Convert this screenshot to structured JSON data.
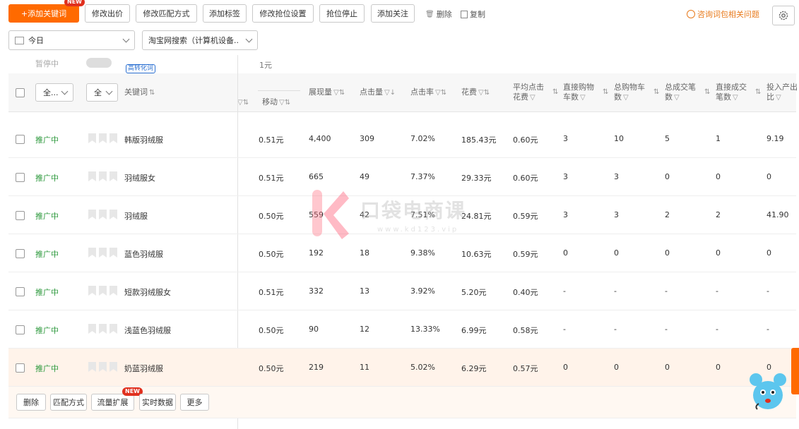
{
  "toolbar": {
    "add_keyword": "+添加关键词",
    "new_badge": "NEW",
    "modify_bid": "修改出价",
    "modify_match": "修改匹配方式",
    "add_tag": "添加标签",
    "modify_rank": "修改抢位设置",
    "stop_rank": "抢位停止",
    "add_follow": "添加关注",
    "delete": "删除",
    "copy": "复制",
    "consult": "咨询词包相关问题"
  },
  "filters": {
    "date": "今日",
    "channel": "淘宝网搜索（计算机设备..."
  },
  "partial_row": {
    "status": "暂停中",
    "badge": "高转化词",
    "value": "1元"
  },
  "header": {
    "status_select": "全...",
    "type_select": "全",
    "keyword": "关键词",
    "mobile": "移动",
    "impressions": "展现量",
    "clicks": "点击量",
    "ctr": "点击率",
    "cost": "花费",
    "avg_cpc": "平均点击花费",
    "direct_cart": "直接购物车数",
    "total_cart": "总购物车数",
    "total_orders": "总成交笔数",
    "direct_orders": "直接成交笔数",
    "roi": "投入产出比"
  },
  "rows": [
    {
      "status": "推广中",
      "keyword": "韩版羽绒服",
      "mobile": "0.51元",
      "impressions": "4,400",
      "clicks": "309",
      "ctr": "7.02%",
      "cost": "185.43元",
      "avg_cpc": "0.60元",
      "direct_cart": "3",
      "total_cart": "10",
      "total_orders": "5",
      "direct_orders": "1",
      "roi": "9.19"
    },
    {
      "status": "推广中",
      "keyword": "羽绒服女",
      "mobile": "0.51元",
      "impressions": "665",
      "clicks": "49",
      "ctr": "7.37%",
      "cost": "29.33元",
      "avg_cpc": "0.60元",
      "direct_cart": "3",
      "total_cart": "3",
      "total_orders": "0",
      "direct_orders": "0",
      "roi": "0"
    },
    {
      "status": "推广中",
      "keyword": "羽绒服",
      "mobile": "0.50元",
      "impressions": "559",
      "clicks": "42",
      "ctr": "7.51%",
      "cost": "24.81元",
      "avg_cpc": "0.59元",
      "direct_cart": "3",
      "total_cart": "3",
      "total_orders": "2",
      "direct_orders": "2",
      "roi": "41.90"
    },
    {
      "status": "推广中",
      "keyword": "蓝色羽绒服",
      "mobile": "0.50元",
      "impressions": "192",
      "clicks": "18",
      "ctr": "9.38%",
      "cost": "10.63元",
      "avg_cpc": "0.59元",
      "direct_cart": "0",
      "total_cart": "0",
      "total_orders": "0",
      "direct_orders": "0",
      "roi": "0"
    },
    {
      "status": "推广中",
      "keyword": "短款羽绒服女",
      "mobile": "0.51元",
      "impressions": "332",
      "clicks": "13",
      "ctr": "3.92%",
      "cost": "5.20元",
      "avg_cpc": "0.40元",
      "direct_cart": "-",
      "total_cart": "-",
      "total_orders": "-",
      "direct_orders": "-",
      "roi": "-"
    },
    {
      "status": "推广中",
      "keyword": "浅蓝色羽绒服",
      "mobile": "0.50元",
      "impressions": "90",
      "clicks": "12",
      "ctr": "13.33%",
      "cost": "6.99元",
      "avg_cpc": "0.58元",
      "direct_cart": "-",
      "total_cart": "-",
      "total_orders": "-",
      "direct_orders": "-",
      "roi": "-"
    },
    {
      "status": "推广中",
      "keyword": "奶蓝羽绒服",
      "mobile": "0.50元",
      "impressions": "219",
      "clicks": "11",
      "ctr": "5.02%",
      "cost": "6.29元",
      "avg_cpc": "0.57元",
      "direct_cart": "0",
      "total_cart": "0",
      "total_orders": "0",
      "direct_orders": "0",
      "roi": "0"
    }
  ],
  "bottom_bar": {
    "delete": "删除",
    "match": "匹配方式",
    "traffic_expand": "流量扩展",
    "realtime": "实时数据",
    "more": "更多",
    "new_badge": "NEW"
  },
  "watermark": {
    "text": "口袋电商课",
    "url": "www.kd123.vip"
  },
  "colors": {
    "primary": "#ff6a00",
    "status_green": "#2f9a3f",
    "badge_red": "#e0301e",
    "link_orange": "#e87a1c"
  }
}
